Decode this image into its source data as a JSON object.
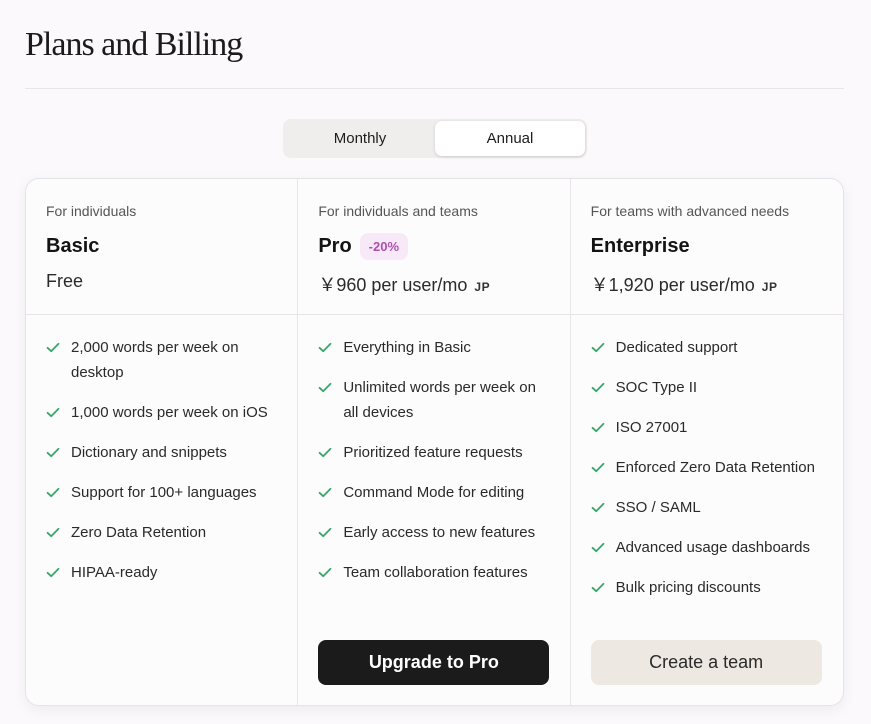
{
  "page": {
    "title": "Plans and Billing"
  },
  "billing_toggle": {
    "options": [
      "Monthly",
      "Annual"
    ],
    "selected": "Annual"
  },
  "plans": [
    {
      "audience": "For individuals",
      "name": "Basic",
      "badge": "",
      "price": "Free",
      "price_suffix": "",
      "features": [
        "2,000 words per week on desktop",
        "1,000 words per week on iOS",
        "Dictionary and snippets",
        "Support for 100+ languages",
        "Zero Data Retention",
        "HIPAA-ready"
      ],
      "cta": ""
    },
    {
      "audience": "For individuals and teams",
      "name": "Pro",
      "badge": "-20%",
      "price": "￥960 per user/mo",
      "price_suffix": "JP",
      "features": [
        "Everything in Basic",
        "Unlimited words per week on all devices",
        "Prioritized feature requests",
        "Command Mode for editing",
        "Early access to new features",
        "Team collaboration features"
      ],
      "cta": "Upgrade to Pro"
    },
    {
      "audience": "For teams with advanced needs",
      "name": "Enterprise",
      "badge": "",
      "price": "￥1,920 per user/mo",
      "price_suffix": "JP",
      "features": [
        "Dedicated support",
        "SOC Type II",
        "ISO 27001",
        "Enforced Zero Data Retention",
        "SSO / SAML",
        "Advanced usage dashboards",
        "Bulk pricing discounts"
      ],
      "cta": "Create a team"
    }
  ],
  "colors": {
    "check": "#3aa56a",
    "badge_bg": "#f8e9f8",
    "badge_text": "#b04fb0",
    "primary_button": "#1b1b1b",
    "secondary_button": "#ede8e2"
  },
  "icons": {
    "feature": "check-icon"
  }
}
